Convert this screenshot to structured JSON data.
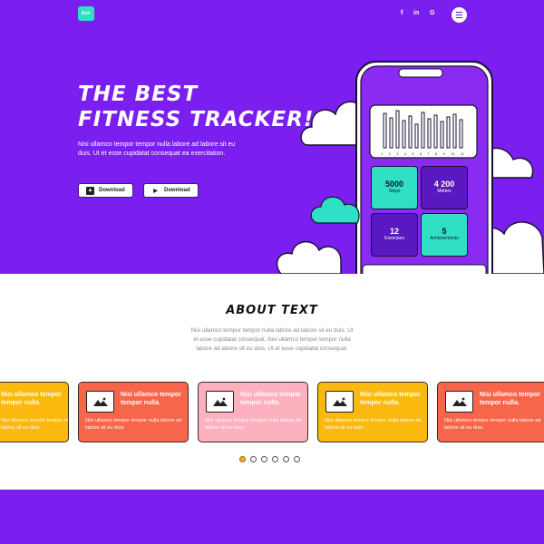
{
  "header": {
    "logo": "Estr",
    "social": [
      "f",
      "in",
      "G"
    ]
  },
  "hero": {
    "title_line1": "The best",
    "title_line2": "fitness tracker!",
    "description": "Nisi ullamco tempor tempor nulla labore ad labore sit eu duis. Ut et esse cupidatat consequat ea exercitation.",
    "download_apple": "Download",
    "download_google": "Download"
  },
  "phone": {
    "chart_labels": [
      "1",
      "2",
      "3",
      "4",
      "5",
      "6",
      "7",
      "8",
      "9",
      "10",
      "11"
    ],
    "tiles": [
      {
        "value": "5000",
        "label": "Steps"
      },
      {
        "value": "4 200",
        "label": "Meters"
      },
      {
        "value": "12",
        "label": "Exercises"
      },
      {
        "value": "5",
        "label": "Achievements"
      }
    ]
  },
  "about": {
    "title": "About text",
    "text": "Nisi ullamco tempor tempor nulla labore ad labore sit eu duis. Ut et esse cupidatat consequat. Nisi ullamco tempor tempor nulla labore ad labore sit eu duis. Ut et esse cupidatat consequat.",
    "cards": [
      {
        "title": "Nisi ullamco tempor tempor nulla.",
        "desc": "Nisi ullamco tempor tempor nulla labore ad labore sit eu duis.",
        "color": "#fbb80f"
      },
      {
        "title": "Nisi ullamco tempor tempor nulla.",
        "desc": "Nisi ullamco tempor tempor nulla labore ad labore sit eu duis.",
        "color": "#f7664a"
      },
      {
        "title": "Nisi ullamco tempor tempor nulla.",
        "desc": "Nisi ullamco tempor tempor nulla labore ad labore sit eu duis.",
        "color": "#fdb0bd"
      },
      {
        "title": "Nisi ullamco tempor tempor nulla.",
        "desc": "Nisi ullamco tempor tempor nulla labore ad labore sit eu duis.",
        "color": "#fbb80f"
      },
      {
        "title": "Nisi ullamco tempor tempor nulla.",
        "desc": "Nisi ullamco tempor tempor nulla labore ad labore sit eu duis.",
        "color": "#f7664a"
      }
    ],
    "carousel_active": 0,
    "carousel_count": 6
  },
  "colors": {
    "brand_purple": "#7a1ff0",
    "accent_teal": "#2fe0c4",
    "card_yellow": "#fbb80f",
    "card_coral": "#f7664a",
    "card_pink": "#fdb0bd"
  },
  "icons": [
    "facebook-icon",
    "linkedin-icon",
    "google-icon",
    "menu-icon",
    "apple-icon",
    "google-play-icon",
    "image-icon"
  ]
}
